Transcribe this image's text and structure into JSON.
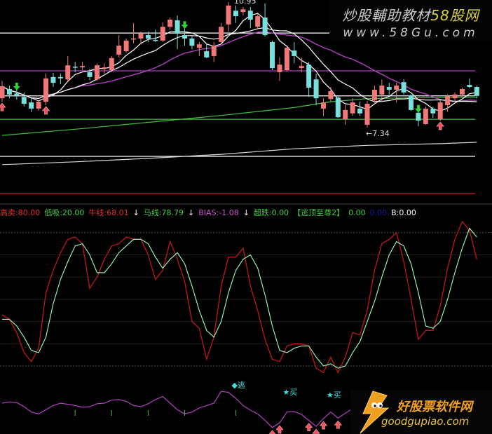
{
  "colors": {
    "up": "#f07878",
    "down": "#78e0dc",
    "ma_short": "#ffffff",
    "ma_mid": "#ffffff",
    "ma20": "#b040c0",
    "green_ma": "#40c040",
    "long_ma": "#d8d8d8",
    "k_line": "#c01818",
    "d_line": "#a0ffc0",
    "osc": "#b040c0",
    "background": "#000000"
  },
  "top_pane": {
    "high_label": "10.95",
    "low_label": "←7.34",
    "ref_lines": [
      {
        "value": 10.05,
        "color": "#ffffff"
      },
      {
        "value": 8.95,
        "color": "#b040c0"
      },
      {
        "value": 8.22,
        "color": "#ffffff"
      },
      {
        "value": 7.54,
        "color": "#40c040"
      },
      {
        "value": 6.46,
        "color": "#ffffff"
      },
      {
        "value": 5.38,
        "color": "#c01828"
      }
    ],
    "down_arrow_bars": [
      2,
      25,
      57
    ],
    "up_arrow_bars": [
      0,
      6,
      60
    ]
  },
  "legend": [
    {
      "text": "高卖:80.00",
      "color": "#e03030"
    },
    {
      "text": "低吸:20.00",
      "color": "#40d040"
    },
    {
      "text": "牛线:68.01",
      "color": "#e03030"
    },
    {
      "text": "↓",
      "color": "#ffffff"
    },
    {
      "text": "马线:78.79",
      "color": "#40d040"
    },
    {
      "text": "↓",
      "color": "#ffffff"
    },
    {
      "text": "BIAS:-1.08",
      "color": "#d050d0"
    },
    {
      "text": "↓",
      "color": "#ffffff"
    },
    {
      "text": "超跌:0.00",
      "color": "#40d040"
    },
    {
      "text": "【逃顶至尊2】",
      "color": "#40d040"
    },
    {
      "text": "0.00",
      "color": "#40d040"
    },
    {
      "text": "0.00",
      "color": "#1818a0"
    },
    {
      "text": "B:0.00",
      "color": "#ffffff"
    }
  ],
  "signals": {
    "escape": {
      "text": "◆逃",
      "bar": 32
    },
    "buy": [
      {
        "text": "★买",
        "bar": 39
      },
      {
        "text": "★买",
        "bar": 45
      }
    ],
    "up_arrow_bars": [
      37,
      38,
      42,
      43,
      44,
      46
    ],
    "tick_bars": [
      10,
      15,
      20,
      25,
      32
    ]
  },
  "watermarks": {
    "top_line1_a": "炒股輔助教材",
    "top_line1_b": "58股网",
    "top_line2": "www.58Gu.com",
    "bottom_line1": "好股票软件网",
    "bottom_line2": "goodgupiao.com"
  },
  "chart_data": {
    "type": "candlestick",
    "title": "",
    "price_range": [
      5.2,
      11.0
    ],
    "ohlc": [
      [
        8.15,
        8.5,
        8.66,
        8.05
      ],
      [
        8.42,
        8.26,
        8.52,
        8.15
      ],
      [
        8.29,
        8.22,
        8.4,
        8.11
      ],
      [
        8.19,
        7.99,
        8.32,
        7.91
      ],
      [
        8.03,
        7.85,
        8.15,
        7.75
      ],
      [
        7.85,
        8.05,
        8.09,
        7.79
      ],
      [
        8.05,
        8.73,
        8.87,
        7.95
      ],
      [
        8.77,
        8.6,
        8.89,
        8.48
      ],
      [
        8.77,
        8.73,
        8.87,
        8.56
      ],
      [
        8.7,
        9.11,
        9.38,
        8.66
      ],
      [
        9.07,
        9.05,
        9.21,
        8.91
      ],
      [
        9.05,
        9.09,
        9.21,
        8.97
      ],
      [
        8.91,
        8.77,
        9.01,
        8.68
      ],
      [
        8.7,
        9.11,
        9.17,
        8.66
      ],
      [
        9.03,
        9.05,
        9.17,
        8.87
      ],
      [
        8.97,
        9.32,
        9.38,
        8.91
      ],
      [
        9.42,
        9.68,
        9.99,
        9.34
      ],
      [
        9.52,
        9.83,
        9.89,
        9.48
      ],
      [
        9.87,
        9.89,
        10.34,
        9.75
      ],
      [
        9.89,
        10.03,
        10.09,
        9.72
      ],
      [
        9.99,
        9.89,
        10.09,
        9.79
      ],
      [
        9.85,
        9.83,
        10.15,
        9.79
      ],
      [
        9.83,
        10.23,
        10.36,
        9.79
      ],
      [
        10.23,
        10.44,
        10.5,
        10.15
      ],
      [
        10.42,
        10.03,
        10.56,
        9.58
      ],
      [
        9.99,
        9.89,
        10.19,
        9.68
      ],
      [
        9.89,
        9.68,
        9.99,
        9.58
      ],
      [
        9.62,
        9.72,
        9.79,
        9.38
      ],
      [
        9.52,
        9.34,
        9.75,
        9.32
      ],
      [
        9.38,
        9.68,
        9.79,
        9.21
      ],
      [
        9.79,
        10.23,
        10.34,
        9.72
      ],
      [
        10.3,
        10.85,
        10.95,
        10.09
      ],
      [
        10.7,
        10.54,
        10.85,
        10.34
      ],
      [
        10.66,
        10.74,
        10.81,
        10.56
      ],
      [
        10.7,
        10.44,
        10.81,
        10.19
      ],
      [
        10.23,
        10.54,
        10.6,
        10.15
      ],
      [
        10.5,
        9.99,
        10.91,
        9.95
      ],
      [
        9.79,
        9.03,
        9.83,
        8.97
      ],
      [
        8.91,
        9.13,
        9.34,
        8.66
      ],
      [
        8.97,
        9.62,
        9.68,
        8.93
      ],
      [
        9.54,
        9.38,
        9.79,
        9.17
      ],
      [
        9.03,
        9.09,
        9.34,
        8.91
      ],
      [
        9.13,
        8.46,
        9.21,
        8.19
      ],
      [
        8.7,
        8.15,
        8.87,
        7.95
      ],
      [
        7.85,
        8.03,
        8.15,
        7.64
      ],
      [
        8.13,
        8.36,
        8.48,
        8.05
      ],
      [
        8.17,
        7.6,
        8.22,
        7.58
      ],
      [
        7.54,
        7.81,
        7.95,
        7.38
      ],
      [
        7.71,
        8.03,
        8.15,
        7.64
      ],
      [
        7.85,
        7.71,
        8.05,
        7.64
      ],
      [
        7.38,
        7.99,
        8.07,
        7.3
      ],
      [
        8.09,
        8.4,
        8.52,
        7.99
      ],
      [
        8.26,
        8.52,
        8.7,
        8.05
      ],
      [
        8.48,
        8.4,
        8.6,
        8.26
      ],
      [
        8.4,
        8.52,
        8.6,
        8.03
      ],
      [
        8.62,
        8.32,
        8.7,
        8.26
      ],
      [
        8.24,
        7.81,
        8.26,
        7.79
      ],
      [
        7.73,
        7.5,
        7.75,
        7.34
      ],
      [
        7.4,
        7.85,
        7.91,
        7.38
      ],
      [
        7.85,
        7.71,
        7.91,
        7.58
      ],
      [
        7.54,
        8.03,
        8.09,
        7.5
      ],
      [
        7.95,
        8.22,
        8.26,
        7.75
      ],
      [
        8.15,
        8.26,
        8.32,
        8.05
      ],
      [
        8.26,
        8.42,
        8.46,
        8.19
      ],
      [
        8.54,
        8.48,
        8.73,
        8.44
      ],
      [
        8.48,
        8.22,
        8.52,
        8.15
      ]
    ],
    "green_ma": [
      [
        0,
        7.07
      ],
      [
        10,
        7.25
      ],
      [
        20,
        7.45
      ],
      [
        30,
        7.65
      ],
      [
        40,
        7.88
      ],
      [
        45,
        8.05
      ],
      [
        50,
        8.14
      ],
      [
        55,
        8.16
      ],
      [
        60,
        8.17
      ],
      [
        65,
        8.18
      ]
    ],
    "long_ma": [
      [
        0,
        6.22
      ],
      [
        10,
        6.3
      ],
      [
        20,
        6.4
      ],
      [
        30,
        6.52
      ],
      [
        40,
        6.68
      ],
      [
        50,
        6.78
      ],
      [
        60,
        6.83
      ],
      [
        65,
        6.87
      ]
    ],
    "indicator": {
      "ylim": [
        0,
        100
      ],
      "levels": [
        80,
        70,
        60,
        50,
        40,
        30,
        20
      ],
      "k": [
        43,
        41,
        35,
        26,
        22,
        28,
        53,
        63,
        71,
        77,
        78,
        75,
        55,
        60,
        68,
        74,
        75,
        78,
        77,
        77,
        70,
        59,
        63,
        76,
        68,
        58,
        40,
        37,
        23,
        33,
        56,
        69,
        69,
        73,
        56,
        45,
        32,
        23,
        22,
        29,
        30,
        30,
        29,
        19,
        17,
        24,
        17,
        24,
        35,
        34,
        45,
        63,
        75,
        77,
        80,
        67,
        50,
        32,
        36,
        36,
        47,
        64,
        77,
        85,
        81,
        68
      ],
      "d": [
        41,
        41,
        38,
        33,
        27,
        26,
        33,
        48,
        59,
        67,
        74,
        75,
        70,
        62,
        62,
        66,
        71,
        74,
        77,
        77,
        75,
        69,
        64,
        68,
        71,
        66,
        56,
        45,
        36,
        33,
        40,
        53,
        63,
        68,
        70,
        64,
        52,
        38,
        27,
        26,
        28,
        29,
        29,
        24,
        20,
        21,
        19,
        20,
        26,
        31,
        40,
        49,
        60,
        70,
        76,
        74,
        66,
        53,
        38,
        37,
        40,
        50,
        62,
        73,
        82,
        78
      ]
    },
    "oscillator": {
      "ylim": [
        0,
        100
      ],
      "values": [
        53,
        55,
        54,
        47,
        38,
        35,
        42,
        49,
        53,
        51,
        49,
        46,
        47,
        52,
        53,
        58,
        59,
        56,
        49,
        47,
        52,
        59,
        64,
        53,
        42,
        35,
        38,
        45,
        49,
        53,
        73,
        71,
        61,
        49,
        41,
        35,
        24,
        12,
        20,
        38,
        39,
        34,
        24,
        14,
        27,
        38,
        28,
        36,
        44
      ]
    }
  }
}
